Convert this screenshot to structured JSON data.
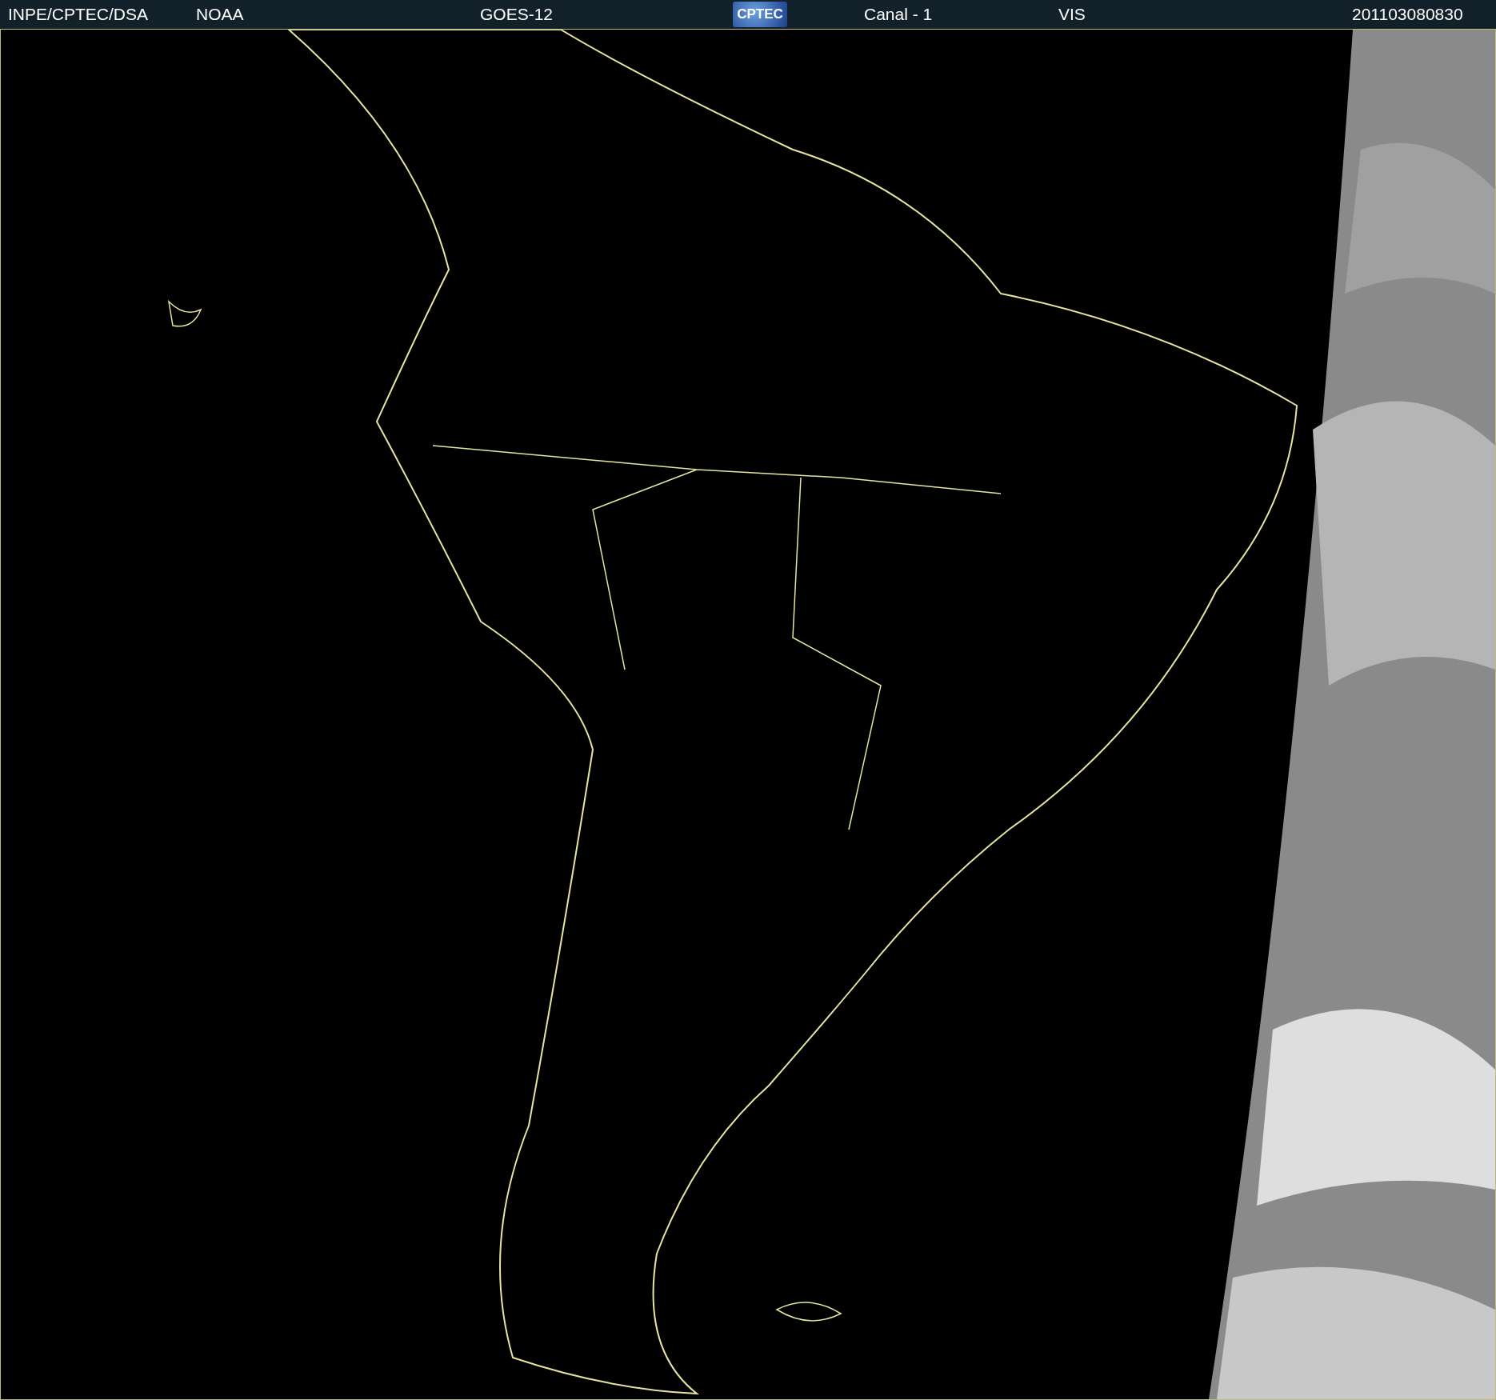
{
  "header": {
    "items": [
      {
        "kind": "text",
        "text": "INPE/CPTEC/DSA"
      },
      {
        "kind": "text",
        "text": "NOAA"
      },
      {
        "kind": "text",
        "text": "GOES-12"
      },
      {
        "kind": "logo",
        "text": "CPTEC"
      },
      {
        "kind": "text",
        "text": "Canal - 1"
      },
      {
        "kind": "text",
        "text": "VIS"
      },
      {
        "kind": "text",
        "text": "201103080830"
      }
    ]
  }
}
